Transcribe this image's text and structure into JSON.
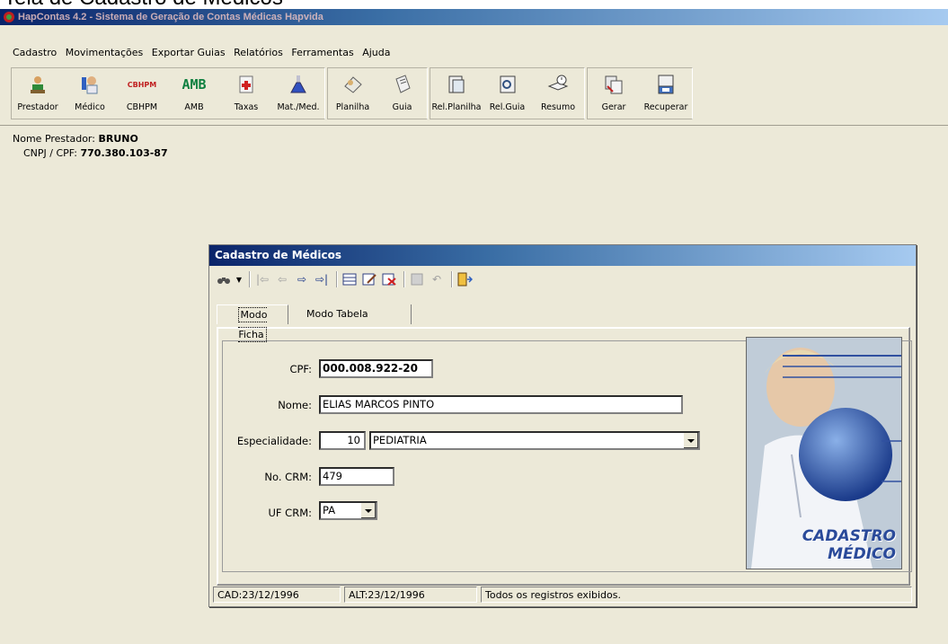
{
  "page": {
    "caption": "Tela de Cadastro de Médicos"
  },
  "app": {
    "title": "HapContas 4.2 - Sistema de Geração de Contas Médicas Hapvida"
  },
  "menu": [
    "Cadastro",
    "Movimentações",
    "Exportar Guias",
    "Relatórios",
    "Ferramentas",
    "Ajuda"
  ],
  "toolbar": {
    "groups": [
      [
        {
          "label": "Prestador",
          "icon": "prestador-icon"
        },
        {
          "label": "Médico",
          "icon": "medico-icon"
        },
        {
          "label": "CBHPM",
          "icon": "cbhpm-icon"
        },
        {
          "label": "AMB",
          "icon": "amb-icon"
        },
        {
          "label": "Taxas",
          "icon": "taxas-icon"
        },
        {
          "label": "Mat./Med.",
          "icon": "flask-icon"
        }
      ],
      [
        {
          "label": "Planilha",
          "icon": "planilha-icon"
        },
        {
          "label": "Guia",
          "icon": "guia-icon"
        }
      ],
      [
        {
          "label": "Rel.Planilha",
          "icon": "report-planilha-icon"
        },
        {
          "label": "Rel.Guia",
          "icon": "report-guia-icon"
        },
        {
          "label": "Resumo",
          "icon": "book-clock-icon"
        }
      ],
      [
        {
          "label": "Gerar",
          "icon": "gerar-icon"
        },
        {
          "label": "Recuperar",
          "icon": "recuperar-icon"
        }
      ]
    ],
    "cbhpm_icon_text": "CBHPM",
    "amb_icon_text": "AMB"
  },
  "prestador": {
    "name_label": "Nome Prestador:",
    "name_value": "BRUNO",
    "cnpj_label": "CNPJ / CPF:",
    "cnpj_value": "770.380.103-87"
  },
  "form": {
    "title": "Cadastro de Médicos",
    "tabs": {
      "ficha": "Modo Ficha",
      "tabela": "Modo Tabela"
    },
    "cpf": {
      "label": "CPF:",
      "value": "000.008.922-20"
    },
    "nome": {
      "label": "Nome:",
      "value": "ELIAS MARCOS PINTO"
    },
    "especialidade": {
      "label": "Especialidade:",
      "code": "10",
      "value": "PEDIATRIA"
    },
    "crm": {
      "label": "No. CRM:",
      "value": "479"
    },
    "uf": {
      "label": "UF CRM:",
      "value": "PA"
    },
    "image_text_line1": "CADASTRO",
    "image_text_line2": "MÉDICO"
  },
  "status": {
    "cad": "CAD:23/12/1996",
    "alt": "ALT:23/12/1996",
    "msg": "Todos os registros exibidos."
  }
}
